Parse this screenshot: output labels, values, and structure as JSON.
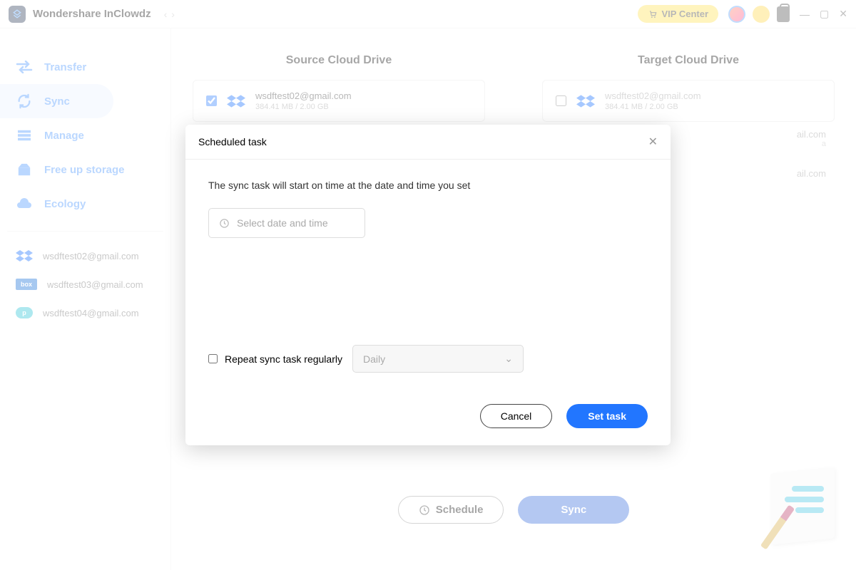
{
  "titlebar": {
    "app_name": "Wondershare InClowdz",
    "vip_label": "VIP Center"
  },
  "sidebar": {
    "items": [
      {
        "label": "Transfer"
      },
      {
        "label": "Sync"
      },
      {
        "label": "Manage"
      },
      {
        "label": "Free up storage"
      },
      {
        "label": "Ecology"
      }
    ],
    "accounts": [
      {
        "email": "wsdftest02@gmail.com",
        "provider": "dropbox"
      },
      {
        "email": "wsdftest03@gmail.com",
        "provider": "box"
      },
      {
        "email": "wsdftest04@gmail.com",
        "provider": "pcloud"
      }
    ]
  },
  "main": {
    "source_title": "Source Cloud Drive",
    "target_title": "Target Cloud Drive",
    "source": {
      "email": "wsdftest02@gmail.com",
      "size": "384.41 MB / 2.00 GB"
    },
    "target": {
      "email": "wsdftest02@gmail.com",
      "size": "384.41 MB / 2.00 GB"
    },
    "target_extra1": "ail.com",
    "target_extra1b": "a",
    "target_extra2": "ail.com",
    "schedule_btn": "Schedule",
    "sync_btn": "Sync"
  },
  "modal": {
    "title": "Scheduled task",
    "desc": "The sync task will start on time at the date and time you set",
    "datetime_placeholder": "Select date and time",
    "repeat_label": "Repeat sync task regularly",
    "repeat_option": "Daily",
    "cancel": "Cancel",
    "set": "Set task"
  }
}
